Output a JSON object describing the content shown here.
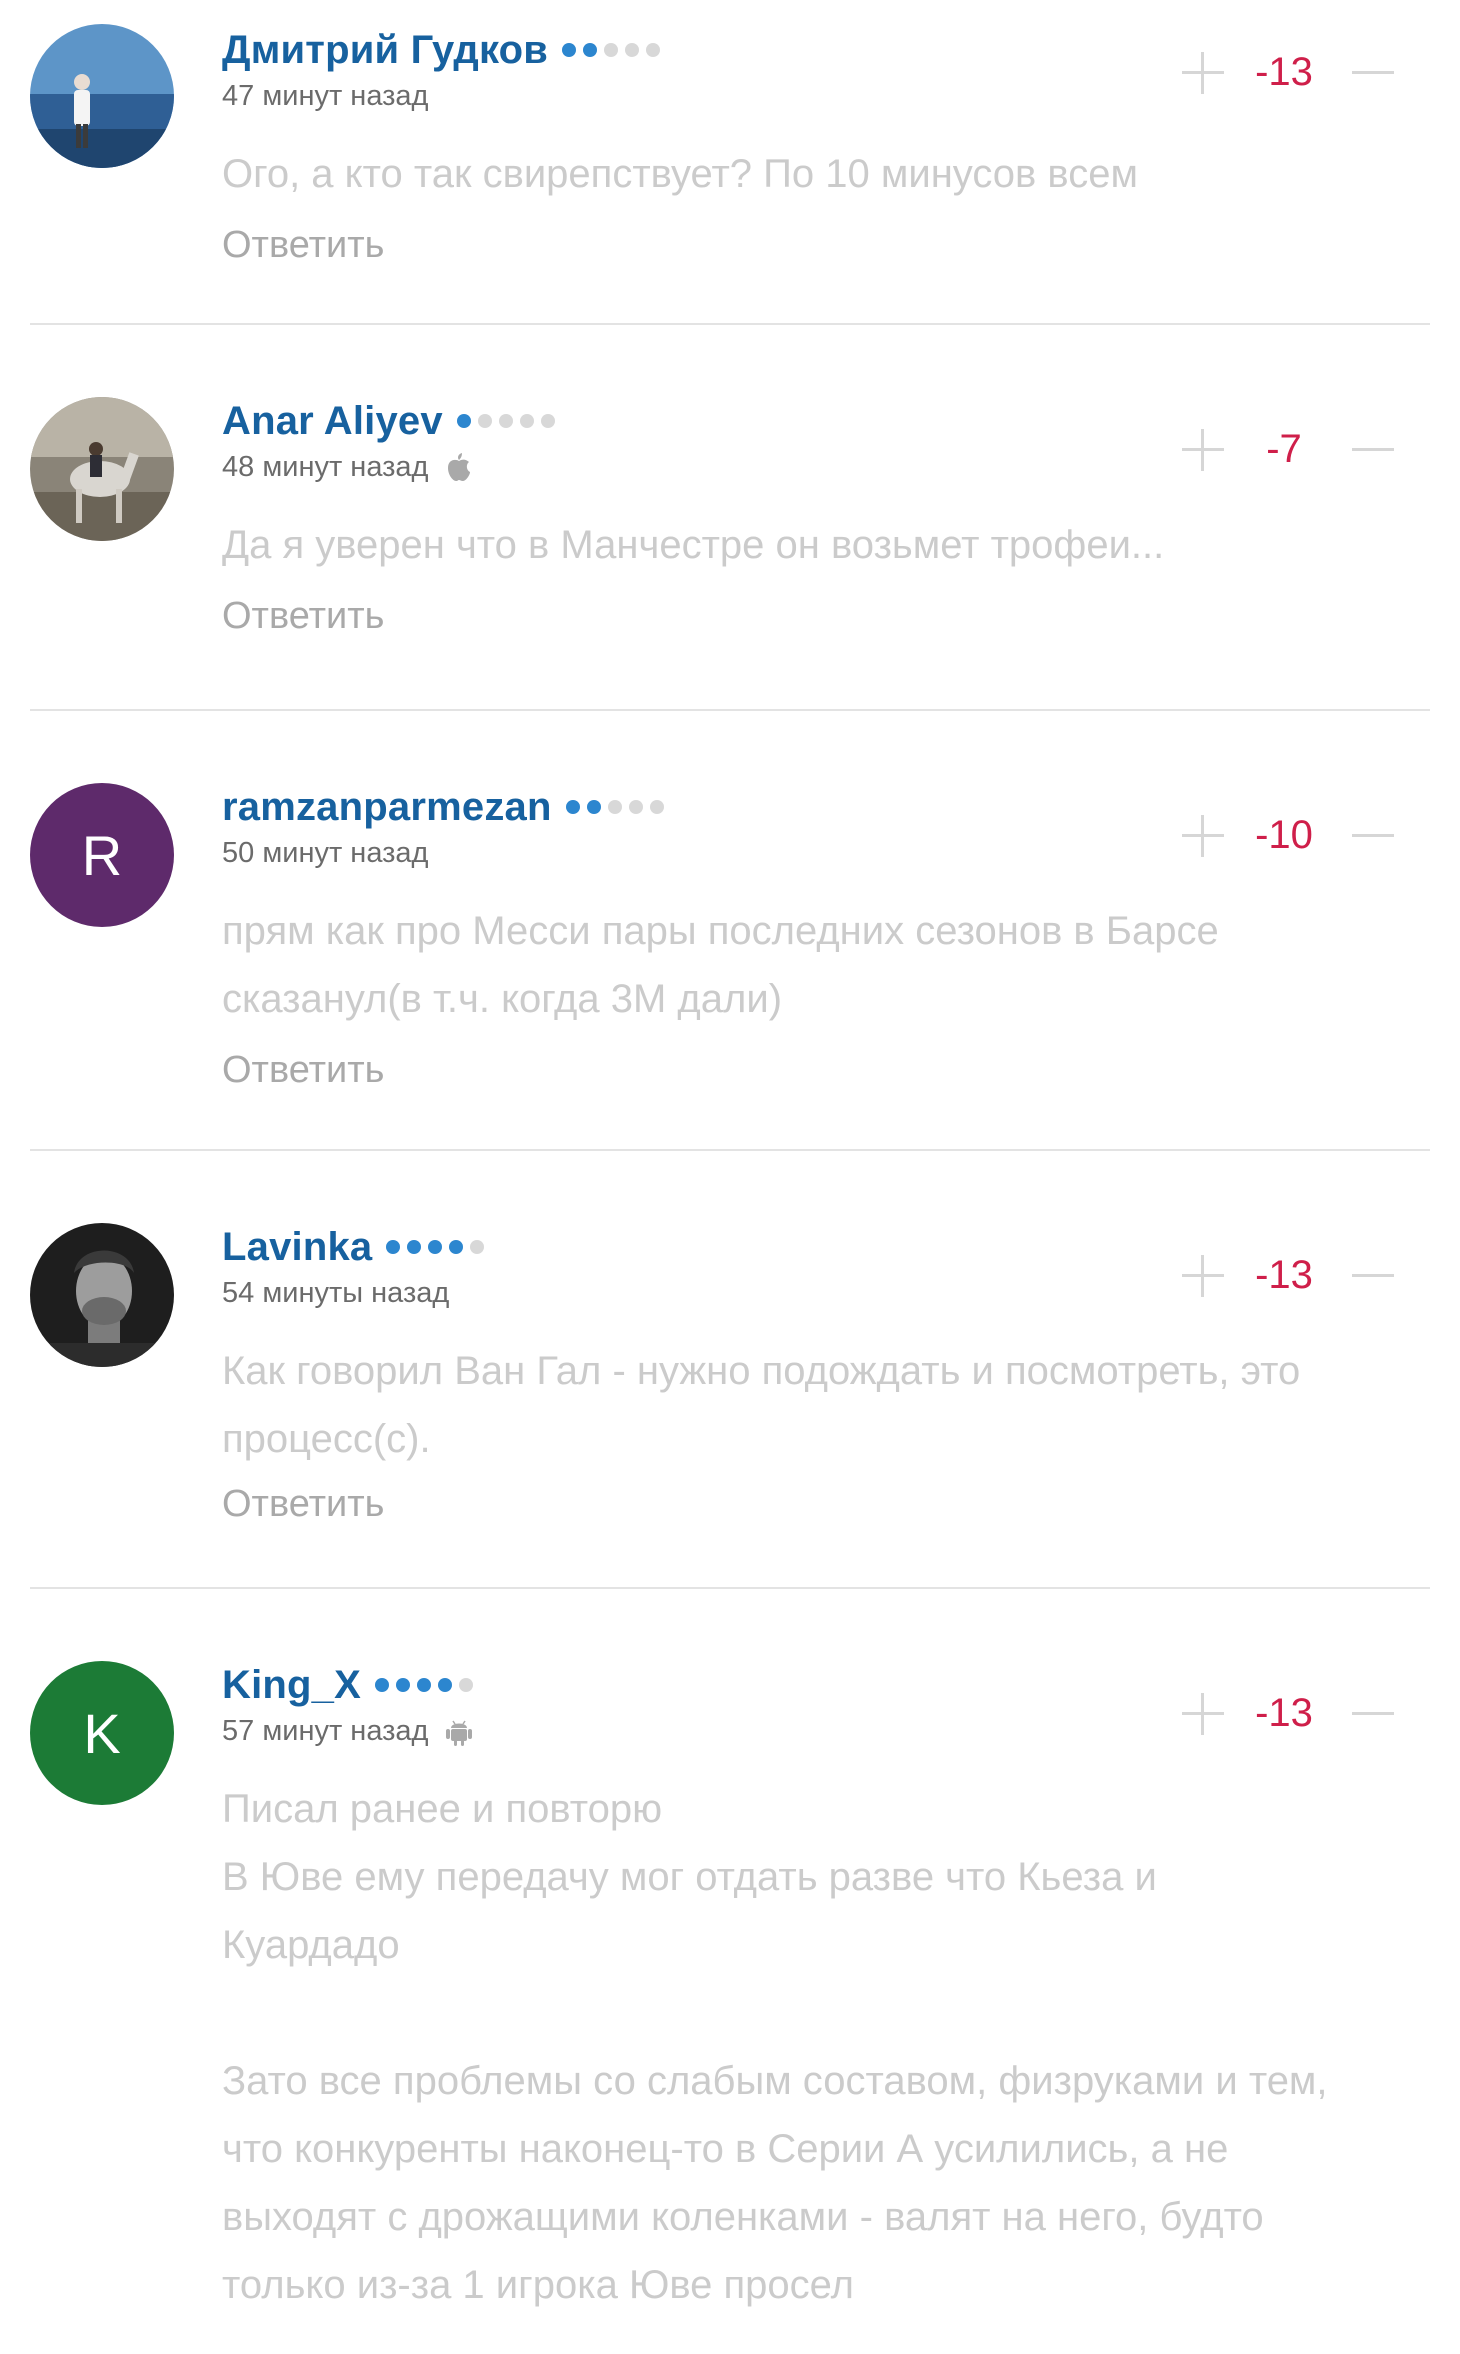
{
  "comments": [
    {
      "author": "Дмитрий Гудков",
      "rating_dots": 2,
      "time": "47 минут назад",
      "platform": "",
      "text": [
        "Ого, а кто так свирепствует? По 10 минусов всем"
      ],
      "reply_label": "Ответить",
      "score": "-13",
      "avatar_letter": "",
      "avatar_type": "photo-sea"
    },
    {
      "author": "Anar Aliyev",
      "rating_dots": 1,
      "time": "48 минут назад",
      "platform": "apple-icon",
      "text": [
        "Да я уверен что в Манчестре он возьмет трофеи..."
      ],
      "reply_label": "Ответить",
      "score": "-7",
      "avatar_letter": "",
      "avatar_type": "photo-horse"
    },
    {
      "author": "ramzanparmezan",
      "rating_dots": 2,
      "time": "50 минут назад",
      "platform": "",
      "text": [
        "прям как про Месси пары последних сезонов в Барсе сказанул(в т.ч. когда 3М дали)"
      ],
      "reply_label": "Ответить",
      "score": "-10",
      "avatar_letter": "R",
      "avatar_color": "#5e2a6b",
      "avatar_type": "letter"
    },
    {
      "author": "Lavinka",
      "rating_dots": 4,
      "time": "54 минуты назад",
      "platform": "",
      "text": [
        "Как говорил Ван Гал - нужно подождать и посмотреть, это процесс(с)."
      ],
      "reply_label": "Ответить",
      "score": "-13",
      "avatar_letter": "",
      "avatar_type": "photo-portrait"
    },
    {
      "author": "King_X",
      "rating_dots": 4,
      "time": "57 минут назад",
      "platform": "android-icon",
      "text": [
        "Писал ранее и повторю",
        "В Юве ему передачу мог отдать разве что Кьеза и Куардадо",
        "",
        "Зато все проблемы со слабым составом, физруками и тем, что конкуренты наконец-то в Серии А усилились, а не выходят с дрожащими коленками - валят на него, будто только из-за 1 игрока Юве просел"
      ],
      "reply_label": "",
      "score": "-13",
      "avatar_letter": "K",
      "avatar_color": "#1c7b36",
      "avatar_type": "letter"
    }
  ],
  "colors": {
    "author": "#17619f",
    "dot_active": "#2c86cf",
    "dot_inactive": "#d8d8d8",
    "score": "#cf1f4a",
    "divider": "#e3e3e3"
  }
}
